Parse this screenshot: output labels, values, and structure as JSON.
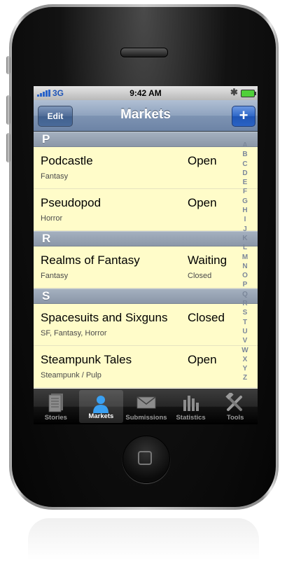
{
  "status_bar": {
    "network": "3G",
    "time": "9:42 AM"
  },
  "nav": {
    "edit_label": "Edit",
    "title": "Markets",
    "add_label": "+"
  },
  "sections": [
    {
      "letter": "P",
      "rows": [
        {
          "title": "Podcastle",
          "status": "Open",
          "genre": "Fantasy",
          "note": ""
        },
        {
          "title": "Pseudopod",
          "status": "Open",
          "genre": "Horror",
          "note": ""
        }
      ]
    },
    {
      "letter": "R",
      "rows": [
        {
          "title": "Realms of Fantasy",
          "status": "Waiting",
          "genre": "Fantasy",
          "note": "Closed"
        }
      ]
    },
    {
      "letter": "S",
      "rows": [
        {
          "title": "Spacesuits and Sixguns",
          "status": "Closed",
          "genre": "SF, Fantasy, Horror",
          "note": ""
        },
        {
          "title": "Steampunk Tales",
          "status": "Open",
          "genre": "Steampunk / Pulp",
          "note": ""
        }
      ]
    }
  ],
  "index_letters": "A B C D E F G H I J K L M N O P Q R S T U V W X Y Z",
  "tabs": [
    {
      "label": "Stories",
      "icon": "stories-icon",
      "active": false
    },
    {
      "label": "Markets",
      "icon": "person-icon",
      "active": true
    },
    {
      "label": "Submissions",
      "icon": "envelope-icon",
      "active": false
    },
    {
      "label": "Statistics",
      "icon": "bar-chart-icon",
      "active": false
    },
    {
      "label": "Tools",
      "icon": "tools-icon",
      "active": false
    }
  ],
  "colors": {
    "row_bg": "#fffcc9",
    "nav_blue": "#6d84a6",
    "add_blue": "#2e67c8"
  }
}
